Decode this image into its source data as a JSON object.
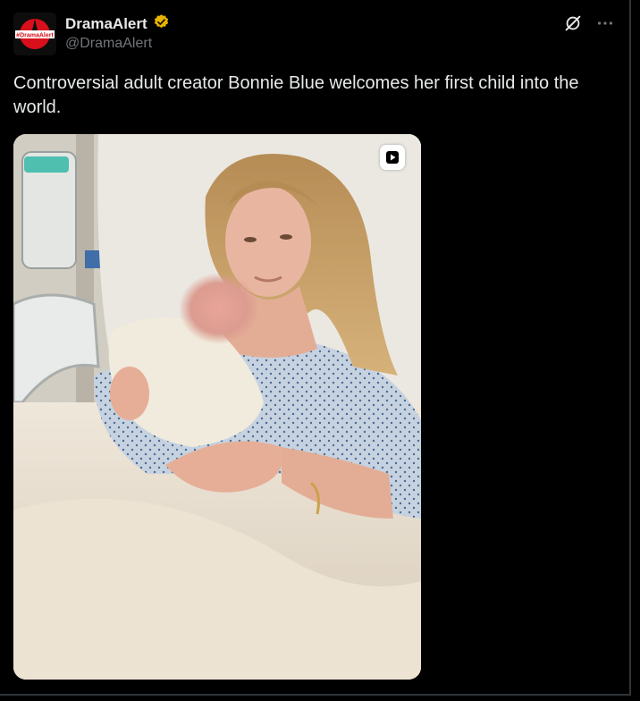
{
  "author": {
    "display_name": "DramaAlert",
    "handle": "@DramaAlert",
    "avatar_text": "#DramaAlert",
    "verified_color": "#e8b400"
  },
  "tweet": {
    "text": "Controversial adult creator Bonnie Blue welcomes her first child into the world."
  },
  "media": {
    "kind": "video",
    "badge_icon": "play-icon"
  },
  "colors": {
    "background": "#000000",
    "text": "#e7e9ea",
    "muted": "#71767b",
    "brand_red": "#d9101b"
  }
}
